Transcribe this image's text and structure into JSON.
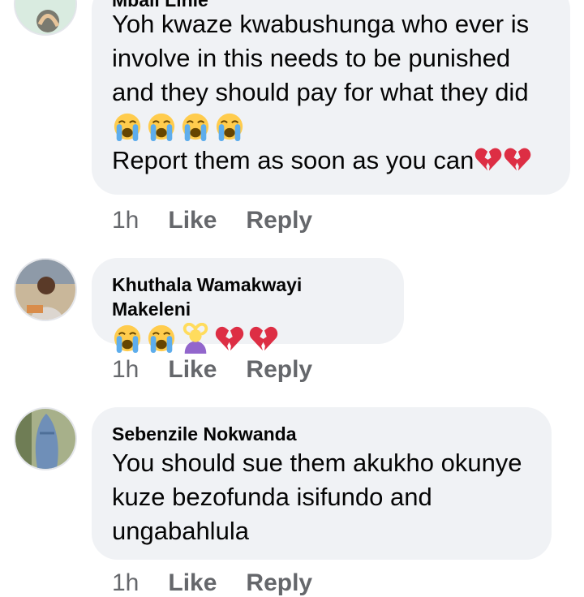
{
  "comments": [
    {
      "author": "Mbali Lihle",
      "lines": [
        "Yoh kwaze kwabushunga who ever is",
        "involve in this needs to be punished",
        "and they should pay for what they did"
      ],
      "emoji_line": [
        "crying-face",
        "crying-face",
        "crying-face",
        "crying-face"
      ],
      "last_line": "Report them as soon as you can",
      "last_emojis": [
        "broken-heart",
        "broken-heart"
      ],
      "time": "1h",
      "like": "Like",
      "reply": "Reply"
    },
    {
      "author": "Khuthala Wamakwayi Makeleni",
      "emoji_line": [
        "crying-face",
        "crying-face",
        "person-gesturing-ok",
        "broken-heart",
        "broken-heart"
      ],
      "time": "1h",
      "like": "Like",
      "reply": "Reply"
    },
    {
      "author": "Sebenzile Nokwanda",
      "lines": [
        "You should sue them akukho okunye",
        "kuze bezofunda isifundo and",
        "ungabahlula"
      ],
      "time": "1h",
      "like": "Like",
      "reply": "Reply"
    }
  ],
  "colors": {
    "bubble": "#f0f2f5",
    "text": "#050505",
    "meta": "#65676b"
  }
}
